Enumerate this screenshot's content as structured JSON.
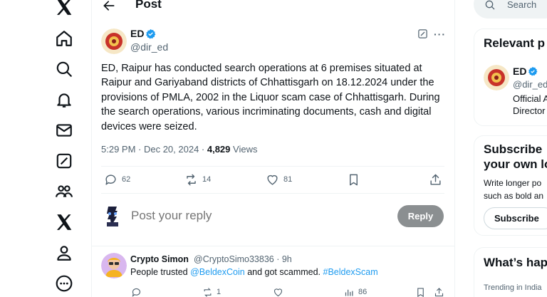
{
  "nav": {
    "items": [
      "x-logo",
      "home-icon",
      "explore-icon",
      "notifications-icon",
      "messages-icon",
      "grok-icon",
      "communities-icon",
      "premium-icon",
      "profile-icon",
      "more-icon"
    ]
  },
  "header": {
    "title": "Post"
  },
  "post": {
    "author_name": "ED",
    "author_handle": "@dir_ed",
    "text": "ED, Raipur has conducted search operations at 6 premises situated at Raipur and Gariyaband districts of Chhattisgarh on 18.12.2024 under the provisions of PMLA, 2002 in the Liquor scam case of Chhattisgarh. During the search operations, various incriminating documents, cash and digital devices were seized.",
    "time": "5:29 PM · Dec 20, 2024 · ",
    "views_count": "4,829",
    "views_label": " Views",
    "replies": "62",
    "reposts": "14",
    "likes": "81"
  },
  "reply_box": {
    "placeholder": "Post your reply",
    "button": "Reply"
  },
  "reply": {
    "name": "Crypto Simon",
    "meta": "@CryptoSimo33836 · 9h",
    "text_before": "People trusted ",
    "mention": "@BeldexCoin",
    "text_middle": " and got scammed. ",
    "hashtag": "#BeldexScam",
    "reposts": "1",
    "views": "86"
  },
  "sidebar": {
    "search_placeholder": "Search",
    "relevant_title": "Relevant p",
    "relevant_name": "ED",
    "relevant_handle": "@dir_ed",
    "relevant_bio_1": "Official A",
    "relevant_bio_2": "Director",
    "subscribe_title_1": "Subscribe",
    "subscribe_title_2": "your own lo",
    "subscribe_text_1": "Write longer po",
    "subscribe_text_2": "such as bold an",
    "subscribe_button": "Subscribe",
    "happening_title": "What’s hap",
    "trending_label": "Trending in India"
  },
  "colors": {
    "accent": "#1d9bf0",
    "text": "#0f1419",
    "muted": "#536471",
    "reply_button": "#8b8f91"
  }
}
